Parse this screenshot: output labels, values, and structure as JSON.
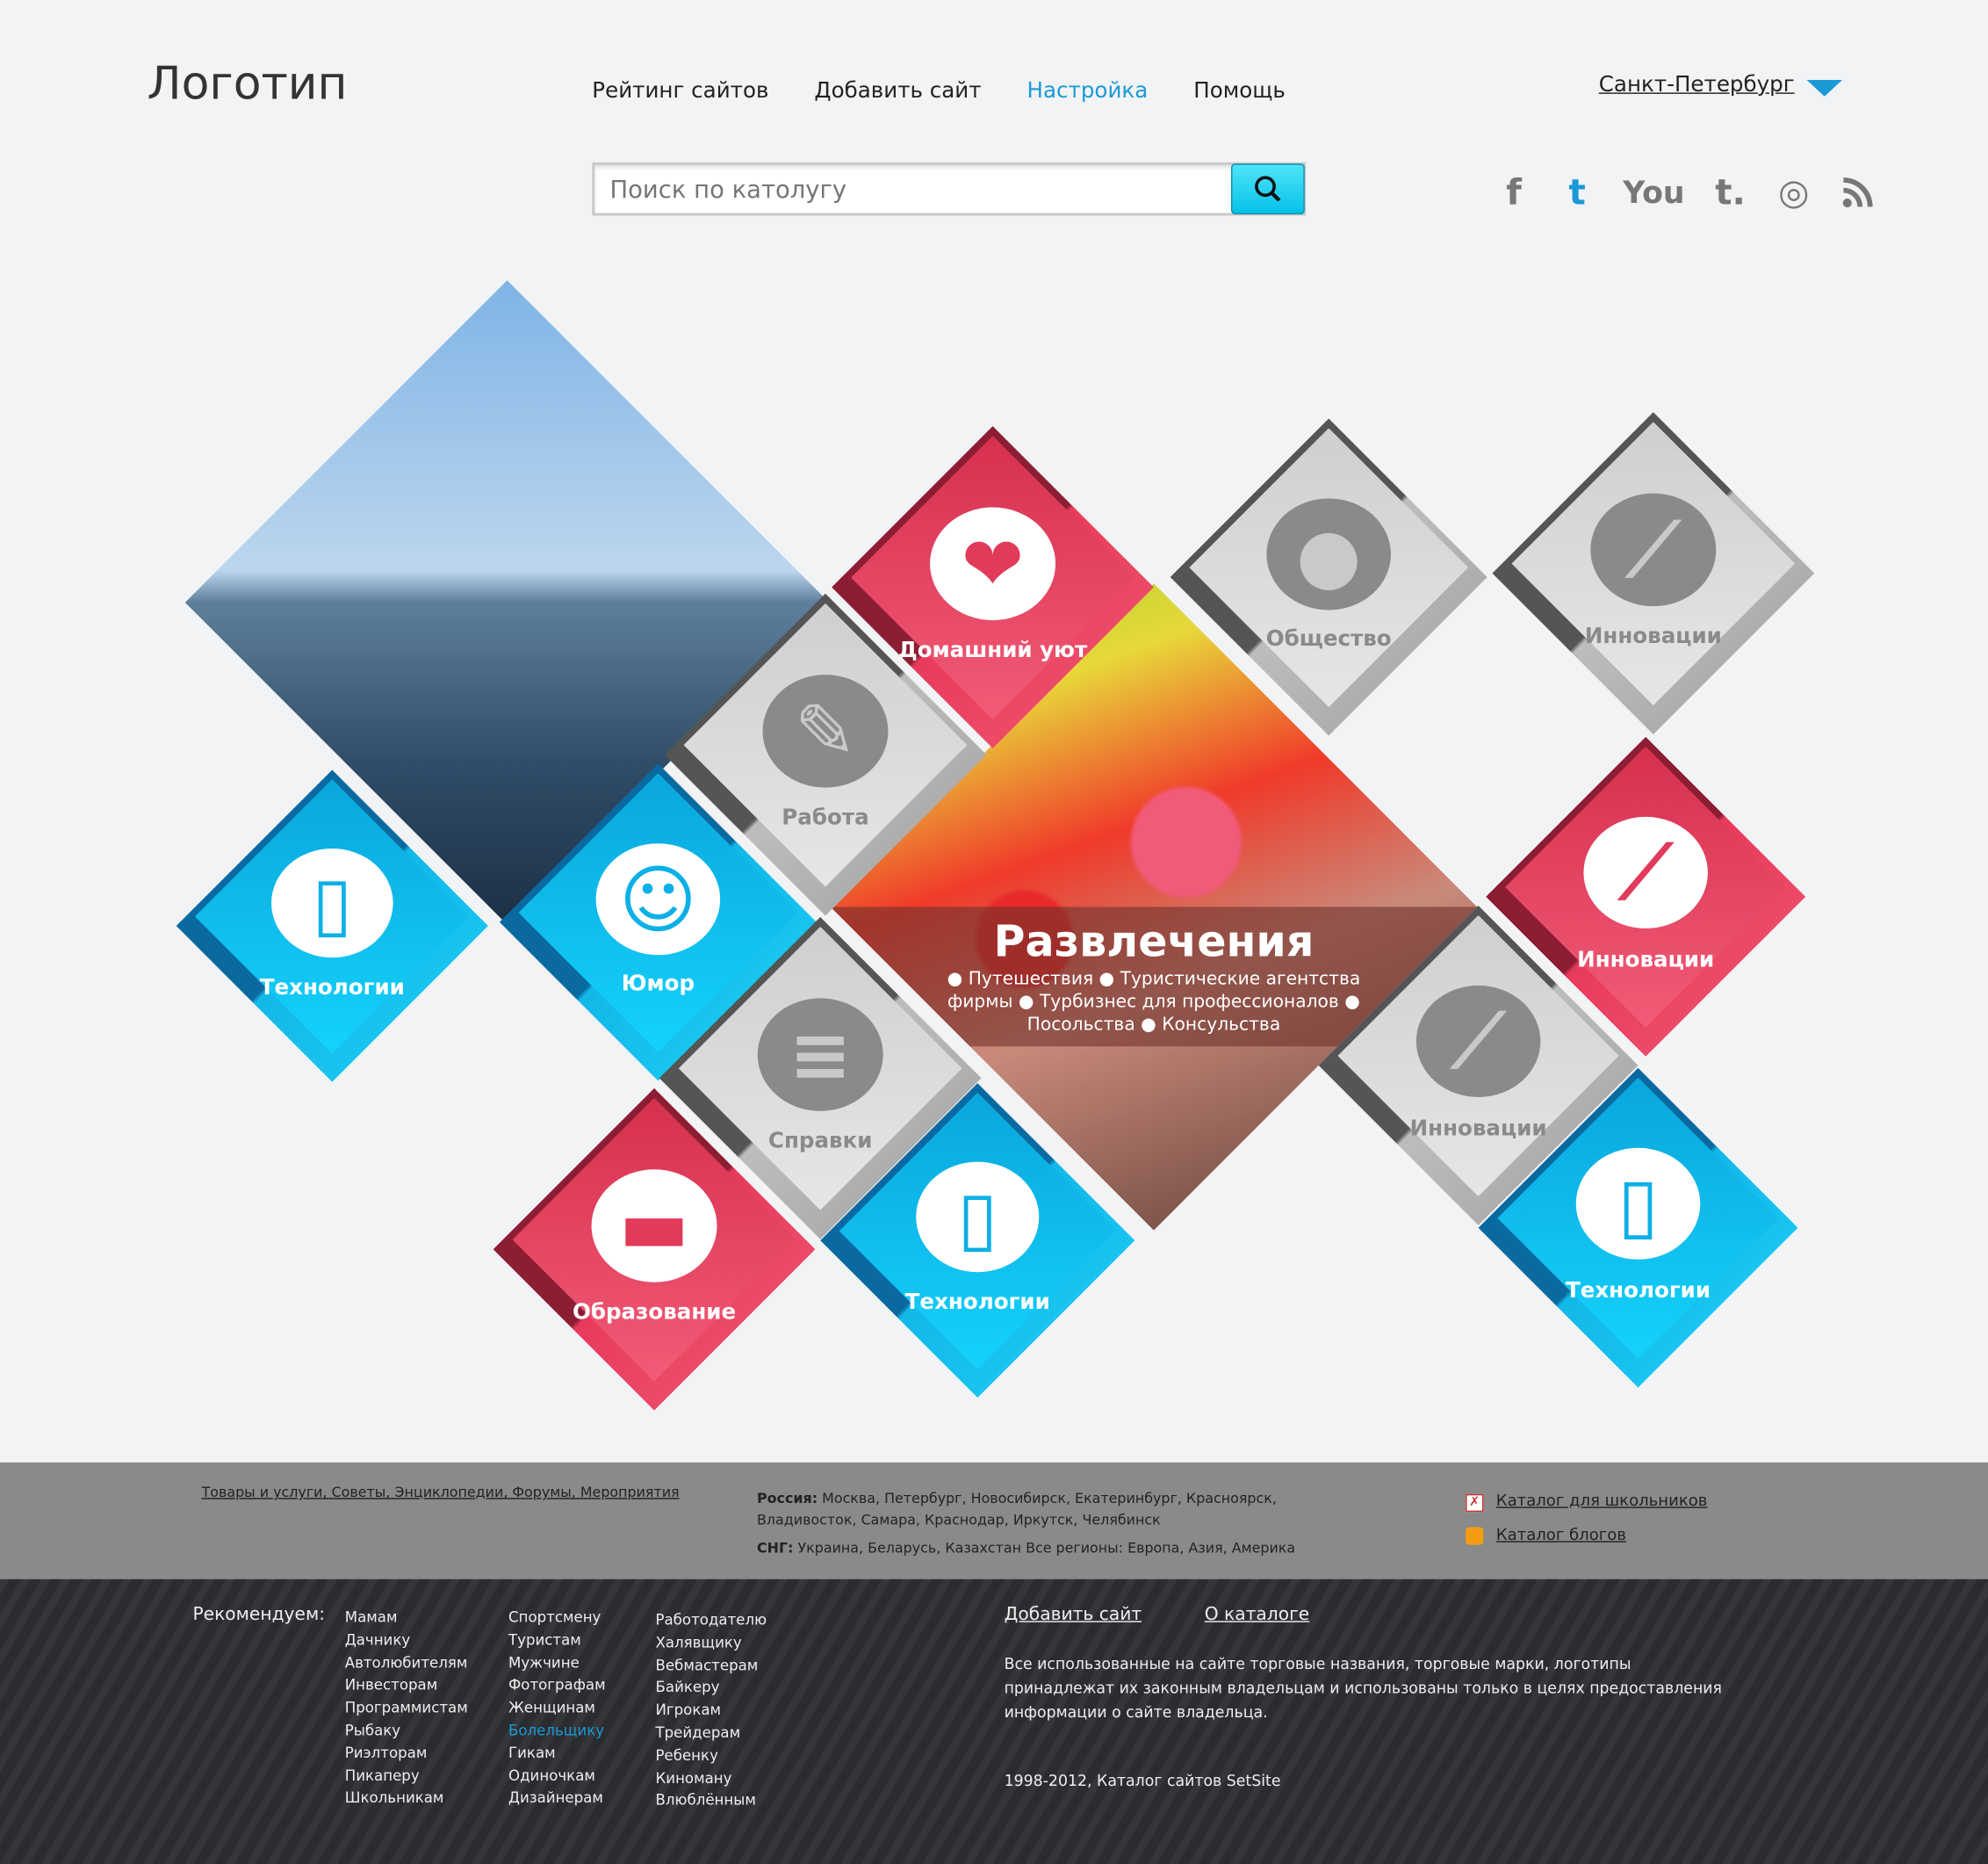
{
  "header": {
    "logo": "Логотип",
    "nav": [
      {
        "label": "Рейтинг сайтов"
      },
      {
        "label": "Добавить сайт"
      },
      {
        "label": "Настройка",
        "active": true
      },
      {
        "label": "Помощь"
      }
    ],
    "city": "Санкт-Петербург",
    "search_placeholder": "Поиск по католугу",
    "social": [
      "f",
      "t",
      "You",
      "t.",
      "◎",
      "rss"
    ],
    "accent": "#1a9ad6"
  },
  "tiles": [
    {
      "label": "Домашний уют",
      "color": "red",
      "icon": "heart-icon"
    },
    {
      "label": "Общество",
      "color": "grey",
      "icon": "speech-bubble-icon"
    },
    {
      "label": "Инновации",
      "color": "grey",
      "icon": "graph-icon"
    },
    {
      "label": "Работа",
      "color": "grey",
      "icon": "wrench-icon"
    },
    {
      "label": "Технологии",
      "color": "blue",
      "icon": "phone-icon"
    },
    {
      "label": "Юмор",
      "color": "blue",
      "icon": "smile-icon"
    },
    {
      "label": "Инновации",
      "color": "red",
      "icon": "graph-icon"
    },
    {
      "label": "Справки",
      "color": "grey",
      "icon": "info-icon"
    },
    {
      "label": "Инновации",
      "color": "grey",
      "icon": "graph-icon"
    },
    {
      "label": "Образование",
      "color": "red",
      "icon": "briefcase-icon"
    },
    {
      "label": "Технологии",
      "color": "blue",
      "icon": "phone-icon"
    },
    {
      "label": "Технологии",
      "color": "blue",
      "icon": "phone-icon"
    }
  ],
  "feature": {
    "title": "Развлечения",
    "items": "● Путешествия ● Туристические агентства фирмы ● Турбизнес для профессионалов ● Посольства ● Консульства"
  },
  "footer": {
    "links": "Товары и услуги, Советы, Энциклопедии, Форумы, Мероприятия",
    "russia_label": "Россия:",
    "russia": "Москва, Петербург, Новосибирск, Екатеринбург, Красноярск, Владивосток, Самара, Краснодар, Иркутск, Челябинск",
    "cis_label": "СНГ:",
    "cis": "Украина, Беларусь, Казахстан  Все регионы: Европа, Азия, Америка",
    "catalog_kids": "Каталог для школьников",
    "catalog_blogs": "Каталог блогов",
    "recommend": "Рекомендуем:",
    "col1": [
      "Мамам",
      "Дачнику",
      "Автолюбителям",
      "Инвесторам",
      "Программистам",
      "Рыбаку",
      "Риэлторам",
      "Пикаперу",
      "Школьникам"
    ],
    "col2": [
      "Спортсмену",
      "Туристам",
      "Мужчине",
      "Фотографам",
      "Женщинам",
      "Болельщику",
      "Гикам",
      "Одиночкам",
      "Дизайнерам"
    ],
    "col3": [
      "Работодателю",
      "Халявщику",
      "Вебмастерам",
      "Байкеру",
      "Игрокам",
      "Трейдерам",
      "Ребенку",
      "Киноману",
      "Влюблённым"
    ],
    "add_site": "Добавить сайт",
    "about": "О каталоге",
    "disclaimer": "Все использованные на сайте торговые названия, торговые марки, логотипы принадлежат их законным владельцам и использованы только в целях предоставления информации о сайте владельца.",
    "copyright": "1998-2012, Каталог сайтов SetSite"
  }
}
